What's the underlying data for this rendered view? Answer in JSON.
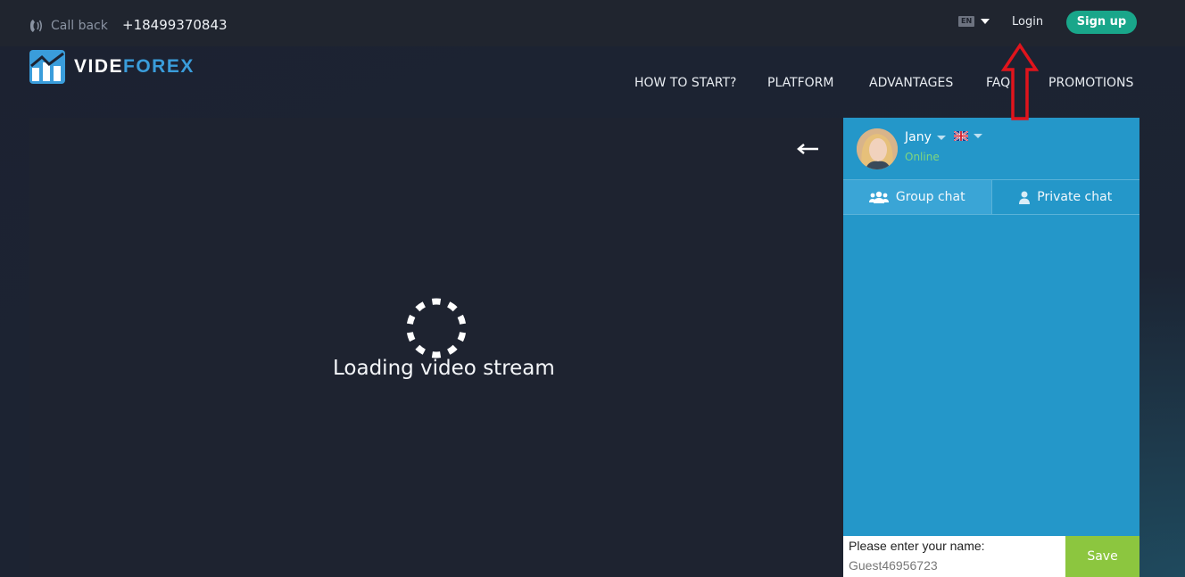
{
  "topbar": {
    "callback_label": "Call back",
    "phone_number": "+18499370843",
    "language": "EN",
    "login_label": "Login",
    "signup_label": "Sign up"
  },
  "brand": {
    "name_part1": "VIDE",
    "name_part2": "FOREX"
  },
  "nav": [
    {
      "label": "HOW TO START?"
    },
    {
      "label": "PLATFORM"
    },
    {
      "label": "ADVANTAGES"
    },
    {
      "label": "FAQ"
    },
    {
      "label": "PROMOTIONS"
    }
  ],
  "video": {
    "loading_text": "Loading video stream"
  },
  "chat": {
    "agent_name": "Jany",
    "status": "Online",
    "tabs": [
      {
        "label": "Group chat",
        "icon": "group-icon"
      },
      {
        "label": "Private chat",
        "icon": "person-icon"
      }
    ],
    "name_prompt": "Please enter your name:",
    "name_value": "Guest46956723",
    "save_label": "Save"
  },
  "colors": {
    "accent": "#2497c9",
    "signup": "#19a68a",
    "save": "#8cc63f",
    "online": "#7fd67f",
    "annotation_arrow": "#e0141c"
  }
}
